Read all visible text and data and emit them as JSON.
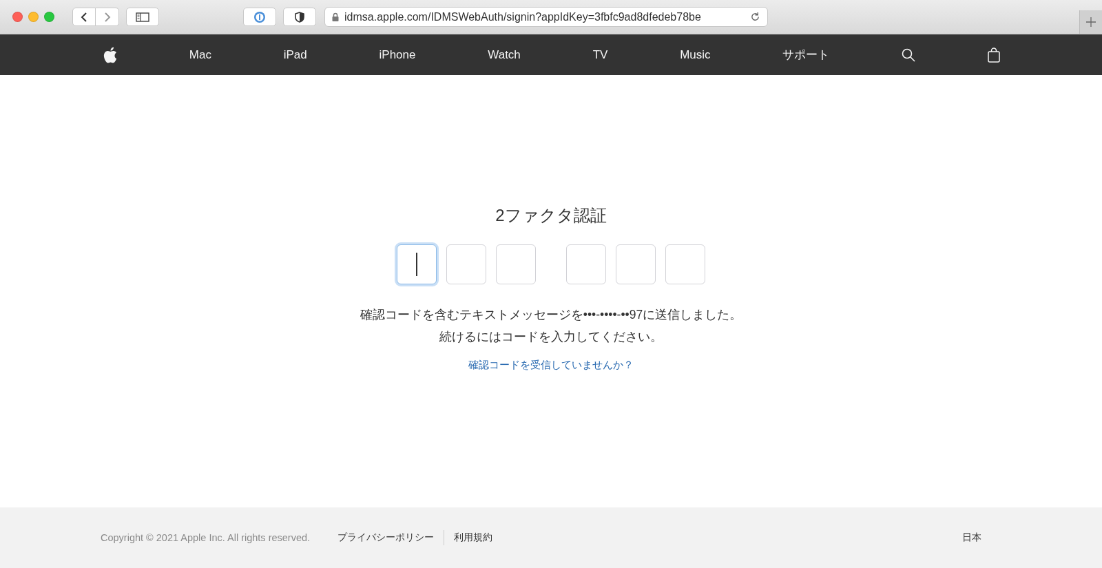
{
  "browser": {
    "url": "idmsa.apple.com/IDMSWebAuth/signin?appIdKey=3fbfc9ad8dfedeb78be"
  },
  "nav": {
    "items": [
      "Mac",
      "iPad",
      "iPhone",
      "Watch",
      "TV",
      "Music",
      "サポート"
    ]
  },
  "title": "2ファクタ認証",
  "code_groups": [
    [
      {
        "focused": true
      },
      {
        "focused": false
      },
      {
        "focused": false
      }
    ],
    [
      {
        "focused": false
      },
      {
        "focused": false
      },
      {
        "focused": false
      }
    ]
  ],
  "message": "確認コードを含むテキストメッセージを•••-••••-••97に送信しました。続けるにはコードを入力してください。",
  "help_link": "確認コードを受信していませんか？",
  "footer": {
    "copyright": "Copyright © 2021 Apple Inc. All rights reserved.",
    "links": [
      "プライバシーポリシー",
      "利用規約"
    ],
    "region": "日本"
  }
}
